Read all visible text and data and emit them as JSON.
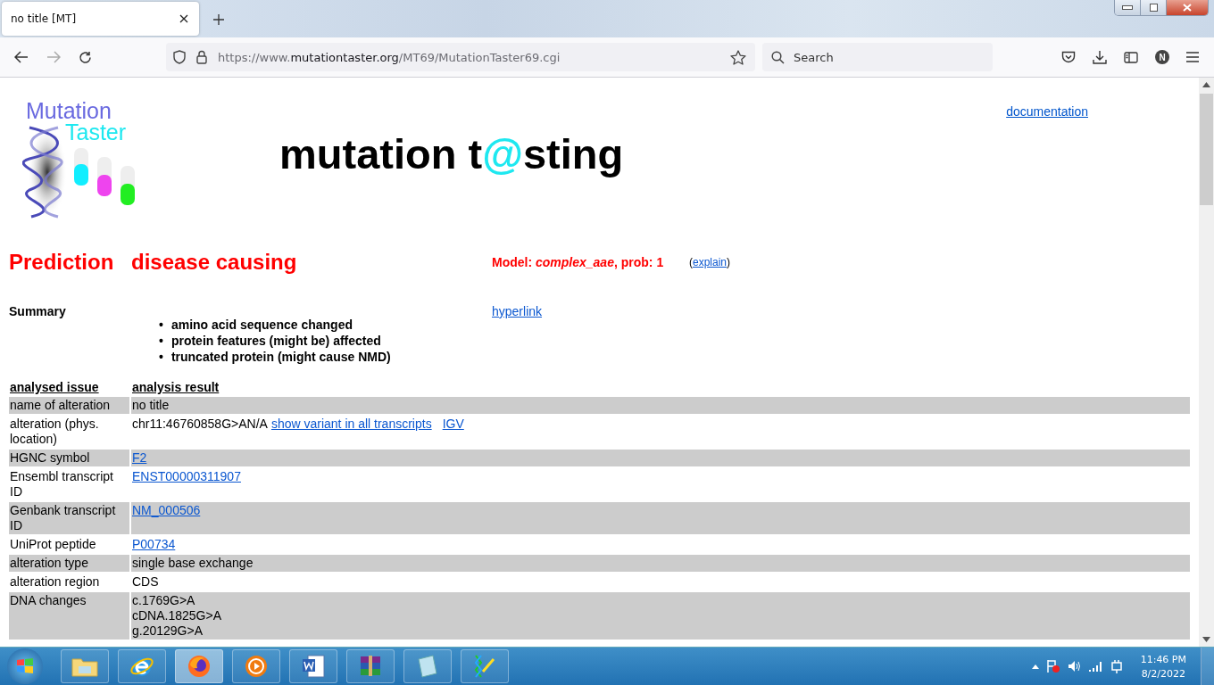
{
  "browser": {
    "tabs": [
      {
        "title": "no title [MT]",
        "selected": true
      }
    ],
    "url": {
      "scheme": "https://www.",
      "domain": "mutationtaster.org",
      "path": "/MT69/MutationTaster69.cgi"
    },
    "search": {
      "placeholder": "Search"
    },
    "profile_initial": "N"
  },
  "page": {
    "logo": {
      "line_1": "Mutation",
      "line_2": "Taster"
    },
    "title": {
      "before": "mutation t",
      "at": "@",
      "after": "sting"
    },
    "documentation_link": "documentation",
    "prediction": {
      "label": "Prediction",
      "result": "disease causing",
      "model_label": "Model:",
      "model": "complex_aae",
      "prob": ", prob: 1",
      "explain_open": "(",
      "explain_link": "explain",
      "explain_close": ")"
    },
    "summary": {
      "label": "Summary",
      "bullet": "•",
      "items": [
        "amino acid sequence changed",
        "protein features (might be) affected",
        "truncated protein (might cause NMD)"
      ],
      "link": "hyperlink"
    },
    "table": {
      "columns": [
        "analysed issue",
        "analysis result"
      ],
      "rows": [
        {
          "label": "name of alteration",
          "lines": [
            [
              {
                "text": "no title",
                "link": false
              }
            ]
          ]
        },
        {
          "label": "alteration (phys. location)",
          "lines": [
            [
              {
                "text": "chr11:46760858G>AN/A",
                "link": false
              },
              {
                "text": "show variant in all transcripts",
                "link": true
              },
              {
                "text": "IGV",
                "link": true
              }
            ]
          ]
        },
        {
          "label": "HGNC symbol",
          "lines": [
            [
              {
                "text": "F2",
                "link": true
              }
            ]
          ]
        },
        {
          "label": "Ensembl transcript ID",
          "lines": [
            [
              {
                "text": "ENST00000311907",
                "link": true
              }
            ]
          ]
        },
        {
          "label": "Genbank transcript ID",
          "lines": [
            [
              {
                "text": "NM_000506",
                "link": true
              }
            ]
          ]
        },
        {
          "label": "UniProt peptide",
          "lines": [
            [
              {
                "text": "P00734",
                "link": true
              }
            ]
          ]
        },
        {
          "label": "alteration type",
          "lines": [
            [
              {
                "text": "single base exchange",
                "link": false
              }
            ]
          ]
        },
        {
          "label": "alteration region",
          "lines": [
            [
              {
                "text": "CDS",
                "link": false
              }
            ]
          ]
        },
        {
          "label": "DNA changes",
          "lines": [
            [
              {
                "text": "c.1769G>A",
                "link": false
              }
            ],
            [
              {
                "text": "cDNA.1825G>A",
                "link": false
              }
            ],
            [
              {
                "text": "g.20129G>A",
                "link": false
              }
            ]
          ]
        }
      ]
    }
  },
  "taskbar": {
    "apps": [
      {
        "kind": "folder",
        "selected": false
      },
      {
        "kind": "ie",
        "selected": false
      },
      {
        "kind": "firefox",
        "selected": true
      },
      {
        "kind": "media",
        "selected": false
      },
      {
        "kind": "word",
        "selected": false
      },
      {
        "kind": "archive",
        "selected": false
      },
      {
        "kind": "notepad",
        "selected": false
      },
      {
        "kind": "tool",
        "selected": false
      }
    ],
    "time": "11:46 PM",
    "date": "8/2/2022"
  }
}
